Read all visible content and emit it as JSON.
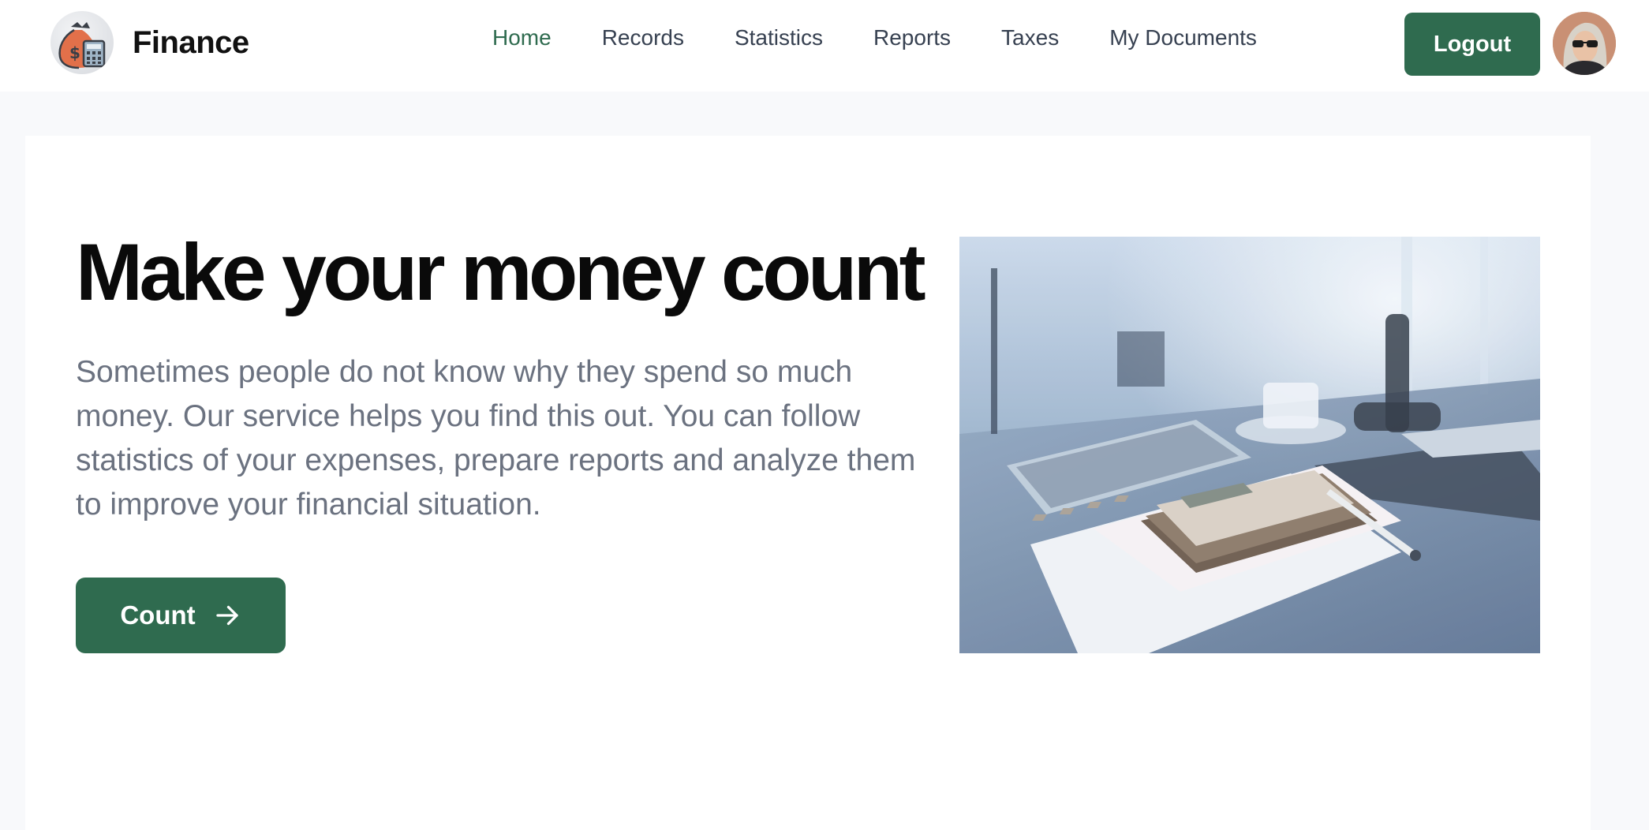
{
  "header": {
    "brand_name": "Finance",
    "logo_icon": "money-bag-calculator-icon",
    "nav": [
      {
        "label": "Home",
        "active": true
      },
      {
        "label": "Records",
        "active": false
      },
      {
        "label": "Statistics",
        "active": false
      },
      {
        "label": "Reports",
        "active": false
      },
      {
        "label": "Taxes",
        "active": false
      },
      {
        "label": "My Documents",
        "active": false
      }
    ],
    "logout_label": "Logout",
    "avatar_icon": "user-avatar"
  },
  "hero": {
    "title": "Make your money count",
    "description": "Sometimes people do not know why they spend so much money. Our service helps you find this out. You can follow statistics of your expenses, prepare reports and analyze them to improve your financial situation.",
    "cta_label": "Count",
    "cta_icon": "arrow-right-icon",
    "image_subject": "calculator-on-desk-photo"
  },
  "colors": {
    "accent": "#2f6b4f",
    "nav_text": "#374151",
    "body_text": "#6b7280",
    "page_bg": "#f8f9fb"
  }
}
